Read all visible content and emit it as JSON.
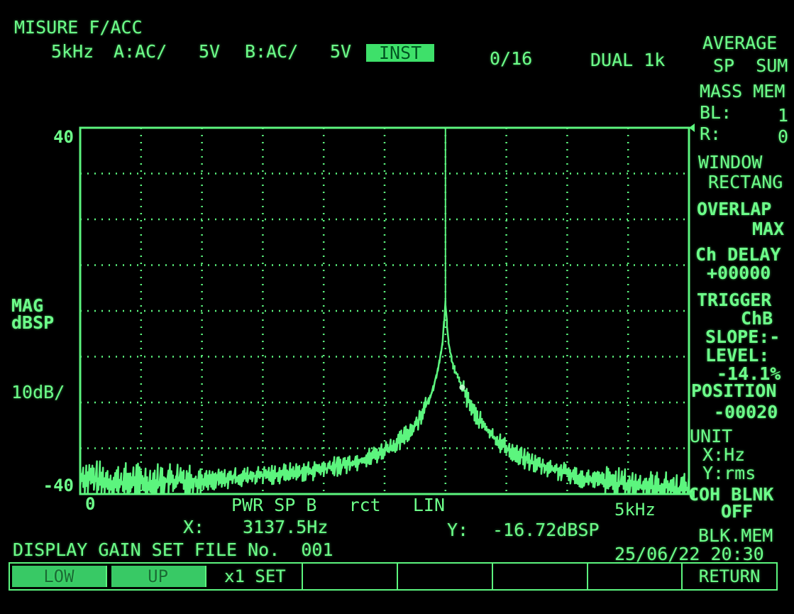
{
  "header": {
    "title": "MISURE F/ACC",
    "line2_freq": "5kHz",
    "chA": "A:AC/",
    "chA_range": "5V",
    "chB": "B:AC/",
    "chB_range": "5V",
    "mode_badge": "INST",
    "average_count": "0/16",
    "dual": "DUAL 1k"
  },
  "side_panel": {
    "average": "AVERAGE",
    "average_modes": "SP  SUM",
    "mass_mem": "MASS MEM",
    "bl_label": "BL:",
    "bl_value": "1",
    "r_label": "R:",
    "r_value": "0",
    "window_label": "WINDOW",
    "window_value": "RECTANG",
    "overlap_label": "OVERLAP",
    "overlap_value": "MAX",
    "ch_delay_label": "Ch DELAY",
    "ch_delay_value": "+00000",
    "trigger_label": "TRIGGER",
    "trigger_value": "ChB",
    "slope": "SLOPE:-",
    "level_label": "LEVEL:",
    "level_value": "-14.1%",
    "position_label": "POSITION",
    "position_value": "-00020",
    "unit_label": "UNIT",
    "unit_x": "X:Hz",
    "unit_y": "Y:rms",
    "coh_blank_label": "COH BLNK",
    "coh_blank_value": "OFF",
    "blk_mem": "BLK.MEM"
  },
  "plot_labels": {
    "ylabel_line1": "MAG",
    "ylabel_line2": "dBSP",
    "yscale": "10dB/",
    "ytick_top": "40",
    "ytick_bottom": "-40",
    "xtick_left": "0",
    "xtick_right": "5kHz",
    "trace_desc": "PWR SP B   rct   LIN"
  },
  "cursor": {
    "x_label": "X:",
    "x_value": "3137.5Hz",
    "y_label": "Y:",
    "y_value": "-16.72dBSP"
  },
  "status": {
    "message": "DISPLAY GAIN SET FILE No.  001",
    "datetime": "25/06/22 20:30"
  },
  "softkeys": [
    "LOW",
    "UP",
    "x1 SET",
    "",
    "",
    "",
    "",
    "RETURN"
  ],
  "colors": {
    "trace": "#5cf57e",
    "background": "#000000",
    "highlight": "#3ee06a"
  },
  "chart_data": {
    "type": "line",
    "title": "",
    "xlabel": "PWR SP B rct LIN",
    "ylabel": "MAG dBSP",
    "xlim": [
      0,
      5000
    ],
    "ylim": [
      -40,
      40
    ],
    "x_unit": "Hz",
    "y_unit": "dBSP",
    "grid": true,
    "x_divisions": 10,
    "y_divisions": 8,
    "series": [
      {
        "peak_x": 3000,
        "peak_y": 1.5,
        "x": [
          0,
          125,
          250,
          375,
          500,
          625,
          750,
          875,
          1000,
          1125,
          1250,
          1375,
          1500,
          1625,
          1750,
          1875,
          2000,
          2125,
          2250,
          2375,
          2500,
          2625,
          2750,
          2875,
          2937.5,
          2975,
          2990,
          3000,
          3010,
          3025,
          3062.5,
          3137.5,
          3250,
          3375,
          3500,
          3625,
          3750,
          3875,
          4000,
          4125,
          4250,
          4375,
          4500,
          4625,
          4750,
          4875,
          5000
        ],
        "y": [
          -36,
          -37,
          -37.5,
          -37.5,
          -37.5,
          -37.5,
          -37.2,
          -37,
          -37,
          -36.8,
          -36.5,
          -36.2,
          -36,
          -35.6,
          -35.3,
          -35,
          -34.5,
          -33.8,
          -33,
          -32,
          -30.5,
          -28.5,
          -25,
          -19,
          -13,
          -7,
          -2,
          1.5,
          -2,
          -7,
          -12,
          -16.72,
          -23,
          -27,
          -30,
          -32,
          -33.5,
          -34.5,
          -35.5,
          -36.5,
          -37,
          -37.5,
          -38,
          -38.2,
          -38.5,
          -38.7,
          -39
        ]
      }
    ]
  }
}
